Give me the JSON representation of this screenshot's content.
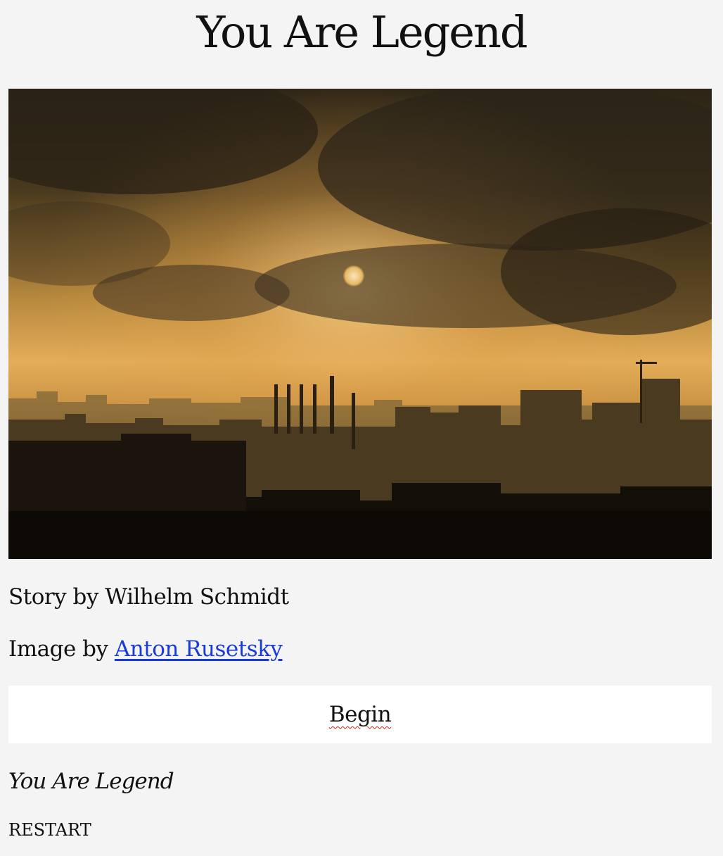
{
  "story": {
    "title": "You Are Legend",
    "author_credit": "Story by Wilhelm Schmidt",
    "image_credit_prefix": "Image by ",
    "image_credit_link": "Anton Rusetsky",
    "begin_label": "Begin",
    "footer_title": "You Are Legend",
    "restart_label": "RESTART"
  },
  "colors": {
    "page_background": "#f4f4f4",
    "link": "#1a3bd6",
    "button_background": "#ffffff",
    "spellcheck_underline": "#d42020"
  },
  "image": {
    "subject": "hazy-city-skyline-at-sunset-with-sun-behind-clouds"
  }
}
